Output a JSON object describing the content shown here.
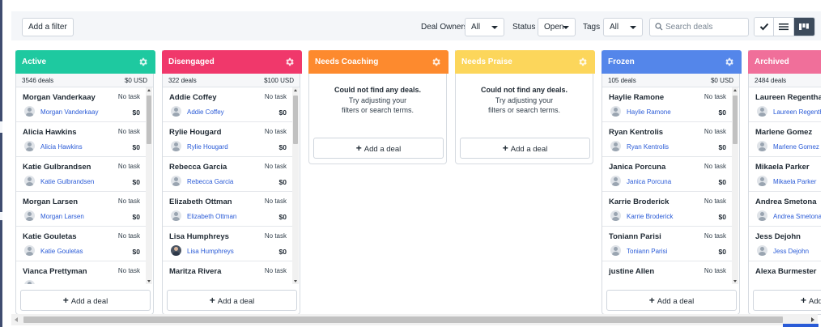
{
  "toolbar": {
    "add_filter": "Add a filter",
    "deal_owners_label": "Deal Owners",
    "deal_owners_value": "All",
    "status_label": "Status",
    "status_value": "Open",
    "tags_label": "Tags",
    "tags_value": "All",
    "search_placeholder": "Search deals",
    "views": [
      "checkmark-icon",
      "list-icon",
      "kanban-icon"
    ],
    "active_view": "kanban"
  },
  "columns": [
    {
      "title": "Active",
      "color": "#1ec9a0",
      "count": "3546 deals",
      "value": "$0 USD",
      "add_label": "Add a deal",
      "deals": [
        {
          "name": "Morgan Vanderkaay",
          "task": "No task",
          "owner": "Morgan Vanderkaay",
          "amount": "$0"
        },
        {
          "name": "Alicia Hawkins",
          "task": "No task",
          "owner": "Alicia Hawkins",
          "amount": "$0"
        },
        {
          "name": "Katie Gulbrandsen",
          "task": "No task",
          "owner": "Katie Gulbrandsen",
          "amount": "$0"
        },
        {
          "name": "Morgan Larsen",
          "task": "No task",
          "owner": "Morgan Larsen",
          "amount": "$0"
        },
        {
          "name": "Katie Gouletas",
          "task": "No task",
          "owner": "Katie Gouletas",
          "amount": "$0"
        },
        {
          "name": "Vianca Prettyman",
          "task": "No task",
          "owner": "",
          "amount": ""
        }
      ]
    },
    {
      "title": "Disengaged",
      "color": "#f0386b",
      "count": "322 deals",
      "value": "$100 USD",
      "add_label": "Add a deal",
      "deals": [
        {
          "name": "Addie Coffey",
          "task": "No task",
          "owner": "Addie Coffey",
          "amount": "$0"
        },
        {
          "name": "Rylie Hougard",
          "task": "No task",
          "owner": "Rylie Hougard",
          "amount": "$0"
        },
        {
          "name": "Rebecca Garcia",
          "task": "No task",
          "owner": "Rebecca Garcia",
          "amount": "$0"
        },
        {
          "name": "Elizabeth Ottman",
          "task": "No task",
          "owner": "Elizabeth Ottman",
          "amount": "$0"
        },
        {
          "name": "Lisa Humphreys",
          "task": "No task",
          "owner": "Lisa Humphreys",
          "amount": "$0",
          "photo": true
        },
        {
          "name": "Maritza Rivera",
          "task": "No task",
          "owner": "",
          "amount": ""
        }
      ]
    },
    {
      "title": "Needs Coaching",
      "color": "#fd8a2e",
      "empty_line1": "Could not find any deals.",
      "empty_line2": "Try adjusting your",
      "empty_line3": "filters or search terms.",
      "add_label": "Add a deal"
    },
    {
      "title": "Needs Praise",
      "color": "#fcd65b",
      "empty_line1": "Could not find any deals.",
      "empty_line2": "Try adjusting your",
      "empty_line3": "filters or search terms.",
      "add_label": "Add a deal"
    },
    {
      "title": "Frozen",
      "color": "#5486ea",
      "count": "105 deals",
      "value": "$0 USD",
      "add_label": "Add a deal",
      "deals": [
        {
          "name": "Haylie Ramone",
          "task": "No task",
          "owner": "Haylie Ramone",
          "amount": "$0"
        },
        {
          "name": "Ryan Kentrolis",
          "task": "No task",
          "owner": "Ryan Kentrolis",
          "amount": "$0"
        },
        {
          "name": "Janica Porcuna",
          "task": "No task",
          "owner": "Janica Porcuna",
          "amount": "$0"
        },
        {
          "name": "Karrie Broderick",
          "task": "No task",
          "owner": "Karrie Broderick",
          "amount": "$0"
        },
        {
          "name": "Toniann Parisi",
          "task": "No task",
          "owner": "Toniann Parisi",
          "amount": "$0"
        },
        {
          "name": "justine Allen",
          "task": "No task",
          "owner": "",
          "amount": ""
        }
      ]
    },
    {
      "title": "Archived",
      "color": "#f06f9a",
      "count": "2484 deals",
      "add_label": "Add a",
      "deals": [
        {
          "name": "Laureen Regenthal",
          "owner": "Laureen Regenthal"
        },
        {
          "name": "Marlene Gomez",
          "owner": "Marlene Gomez"
        },
        {
          "name": "Mikaela Parker",
          "owner": "Mikaela Parker"
        },
        {
          "name": "Andrea Smetona",
          "owner": "Andrea Smetona"
        },
        {
          "name": "Jess Dejohn",
          "owner": "Jess Dejohn"
        },
        {
          "name": "Alexa Burmester",
          "owner": ""
        }
      ]
    }
  ]
}
